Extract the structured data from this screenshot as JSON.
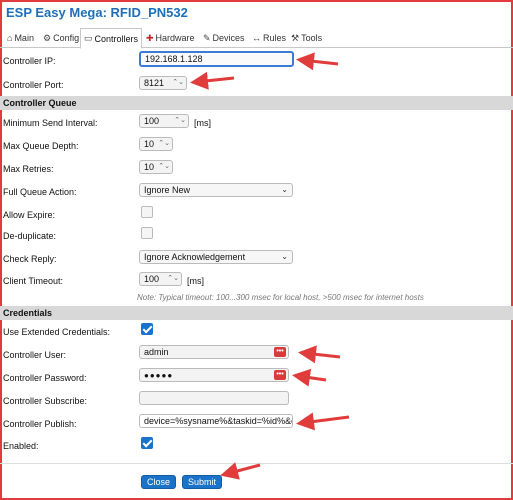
{
  "app_title": "ESP Easy Mega: RFID_PN532",
  "tabs": [
    {
      "icon": "house-icon",
      "glyph": "⌂",
      "label": "Main"
    },
    {
      "icon": "gear-icon",
      "glyph": "⚙",
      "label": "Config"
    },
    {
      "icon": "chat-icon",
      "glyph": "💬",
      "label": "Controllers"
    },
    {
      "icon": "pin-icon",
      "glyph": "📌",
      "label": "Hardware"
    },
    {
      "icon": "plug-icon",
      "glyph": "🔌",
      "label": "Devices"
    },
    {
      "icon": "arrows-icon",
      "glyph": "⇆",
      "label": "Rules"
    },
    {
      "icon": "wrench-icon",
      "glyph": "🔧",
      "label": "Tools"
    }
  ],
  "controller": {
    "ip_label": "Controller IP:",
    "ip_value": "192.168.1.128",
    "port_label": "Controller Port:",
    "port_value": "8121"
  },
  "queue": {
    "section_title": "Controller Queue",
    "min_send_label": "Minimum Send Interval:",
    "min_send_value": "100",
    "min_send_unit": "[ms]",
    "max_depth_label": "Max Queue Depth:",
    "max_depth_value": "10",
    "max_retries_label": "Max Retries:",
    "max_retries_value": "10",
    "full_action_label": "Full Queue Action:",
    "full_action_value": "Ignore New",
    "allow_expire_label": "Allow Expire:",
    "allow_expire_checked": false,
    "dedup_label": "De-duplicate:",
    "dedup_checked": false,
    "check_reply_label": "Check Reply:",
    "check_reply_value": "Ignore Acknowledgement",
    "client_timeout_label": "Client Timeout:",
    "client_timeout_value": "100",
    "client_timeout_unit": "[ms]",
    "note": "Note: Typical timeout: 100...300 msec for local host, >500 msec for internet hosts"
  },
  "credentials": {
    "section_title": "Credentials",
    "use_ext_label": "Use Extended Credentials:",
    "use_ext_checked": true,
    "user_label": "Controller User:",
    "user_value": "admin",
    "password_label": "Controller Password:",
    "password_value": "●●●●●",
    "subscribe_label": "Controller Subscribe:",
    "subscribe_value": "",
    "publish_label": "Controller Publish:",
    "publish_value": "device=%sysname%&taskid=%id%&cm",
    "enabled_label": "Enabled:",
    "enabled_checked": true
  },
  "buttons": {
    "close": "Close",
    "submit": "Submit"
  },
  "colors": {
    "accent": "#1a73c9",
    "title": "#1f6fb7",
    "annotation": "#e03c3c"
  }
}
